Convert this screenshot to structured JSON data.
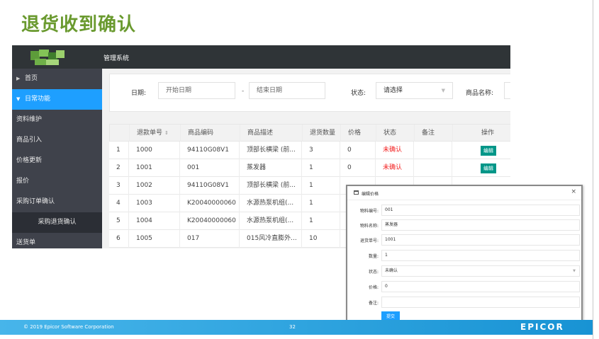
{
  "slide": {
    "title": "退货收到确认",
    "footer": {
      "copyright": "© 2019 Epicor Software Corporation",
      "page_number": "32",
      "logo_text": "EPICOR"
    }
  },
  "app": {
    "name": "管理系统",
    "sidebar": {
      "items": [
        {
          "label": "首页"
        },
        {
          "label": "日常功能"
        },
        {
          "label": "资料维护"
        },
        {
          "label": "商品引入"
        },
        {
          "label": "价格更新"
        },
        {
          "label": "报价"
        },
        {
          "label": "采购订单确认"
        },
        {
          "label": "采购退货确认"
        },
        {
          "label": "送货单"
        }
      ]
    },
    "filter": {
      "date_label": "日期:",
      "start_placeholder": "开始日期",
      "separator": "-",
      "end_placeholder": "结束日期",
      "status_label": "状态:",
      "status_value": "请选择",
      "product_name_label": "商品名称:"
    },
    "table": {
      "columns": [
        "",
        "退款单号",
        "商品编码",
        "商品描述",
        "退货数量",
        "价格",
        "状态",
        "备注",
        "操作"
      ],
      "rows": [
        {
          "idx": "1",
          "no": "1000",
          "code": "94110G08V1",
          "desc": "顶部长横梁 (前...",
          "qty": "3",
          "price": "0",
          "status": "未确认",
          "note": "",
          "action": "编辑"
        },
        {
          "idx": "2",
          "no": "1001",
          "code": "001",
          "desc": "蒸发器",
          "qty": "1",
          "price": "0",
          "status": "未确认",
          "note": "",
          "action": "编辑"
        },
        {
          "idx": "3",
          "no": "1002",
          "code": "94110G08V1",
          "desc": "顶部长横梁 (前...",
          "qty": "1",
          "price": "",
          "status": "",
          "note": "",
          "action": ""
        },
        {
          "idx": "4",
          "no": "1003",
          "code": "K20040000060",
          "desc": "水源热泵机组(...",
          "qty": "1",
          "price": "",
          "status": "",
          "note": "",
          "action": ""
        },
        {
          "idx": "5",
          "no": "1004",
          "code": "K20040000060",
          "desc": "水源热泵机组(...",
          "qty": "1",
          "price": "",
          "status": "",
          "note": "",
          "action": ""
        },
        {
          "idx": "6",
          "no": "1005",
          "code": "017",
          "desc": "015风冷直膨外...",
          "qty": "10",
          "price": "",
          "status": "",
          "note": "",
          "action": ""
        }
      ]
    }
  },
  "dialog": {
    "title": "编辑价格",
    "close": "×",
    "fields": [
      {
        "label": "物料编号:",
        "value": "001"
      },
      {
        "label": "物料名称:",
        "value": "蒸发器"
      },
      {
        "label": "退货单号:",
        "value": "1001"
      },
      {
        "label": "数量:",
        "value": "1"
      },
      {
        "label": "状态:",
        "value": "未确认"
      },
      {
        "label": "价格:",
        "value": "0"
      },
      {
        "label": "备注:",
        "value": ""
      }
    ],
    "submit": "提交"
  },
  "colors": {
    "title_green": "#6a9a2f",
    "sidebar_active": "#1e9fff",
    "edit_button": "#009688",
    "status_red": "#f32121"
  }
}
